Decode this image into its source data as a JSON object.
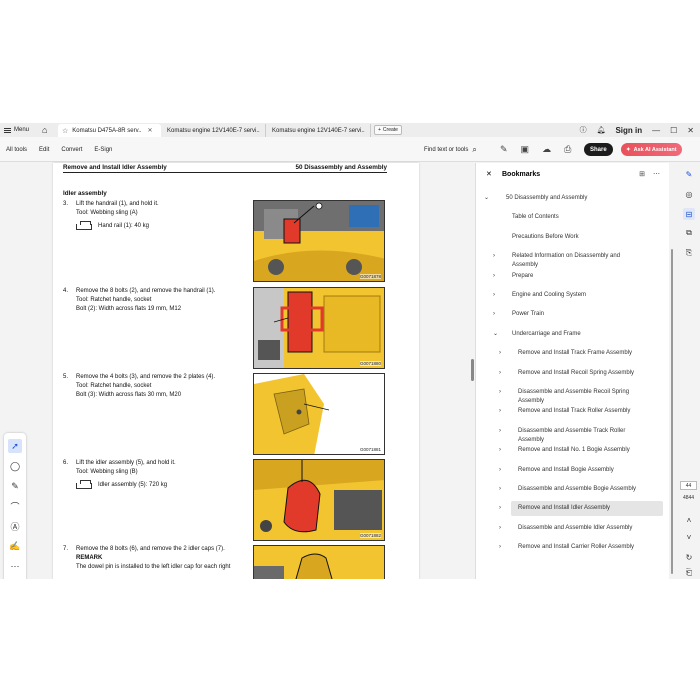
{
  "titlebar": {
    "menu_label": "Menu",
    "tabs": [
      {
        "label": "Komatsu D475A-8R serv..",
        "active": true
      },
      {
        "label": "Komatsu engine 12V140E-7 servi..",
        "active": false
      },
      {
        "label": "Komatsu engine 12V140E-7 servi..",
        "active": false
      }
    ],
    "create_label": "Create",
    "signin_label": "Sign in"
  },
  "toolbar": {
    "items": [
      "All tools",
      "Edit",
      "Convert",
      "E-Sign"
    ],
    "find_label": "Find text or tools",
    "share_label": "Share",
    "ai_label": "Ask AI Assistant"
  },
  "document": {
    "header_left": "Remove and Install Idler Assembly",
    "header_right": "50 Disassembly and Assembly",
    "section_title": "Idler assembly",
    "steps": [
      {
        "num": "3.",
        "lines": [
          "Lift the handrail (1), and hold it.",
          "Tool: Webbing sling (A)"
        ],
        "tag": "Hand rail (1): 40 kg"
      },
      {
        "num": "4.",
        "lines": [
          "Remove the 8 bolts (2), and remove the handrail (1).",
          "Tool: Ratchet handle, socket",
          "Bolt (2): Width across flats 19 mm, M12"
        ]
      },
      {
        "num": "5.",
        "lines": [
          "Remove the 4 bolts (3), and remove the 2 plates (4).",
          "Tool: Ratchet handle, socket",
          "Bolt (3): Width across flats 30 mm, M20"
        ]
      },
      {
        "num": "6.",
        "lines": [
          "Lift the idler assembly (5), and hold it.",
          "Tool: Webbing sling (B)"
        ],
        "tag": "Idler assembly (5): 720 kg"
      },
      {
        "num": "7.",
        "lines": [
          "Remove the 8 bolts (6), and remove the 2 idler caps (7)."
        ],
        "remark": "REMARK",
        "extra": "The dowel pin is installed to the left idler cap for each right"
      }
    ],
    "figure_codes": [
      "G0071878",
      "G0071880",
      "G0071881",
      "G0071882"
    ]
  },
  "bookmarks": {
    "title": "Bookmarks",
    "items": [
      {
        "label": "50 Disassembly and Assembly",
        "level": 0,
        "chevron": "down"
      },
      {
        "label": "Table of Contents",
        "level": 1,
        "chevron": "none"
      },
      {
        "label": "Precautions Before Work",
        "level": 1,
        "chevron": "none"
      },
      {
        "label": "Related Information on Disassembly and",
        "label2": "Assembly",
        "level": 1,
        "chevron": "right"
      },
      {
        "label": "Prepare",
        "level": 1,
        "chevron": "right"
      },
      {
        "label": "Engine and Cooling System",
        "level": 1,
        "chevron": "right"
      },
      {
        "label": "Power Train",
        "level": 1,
        "chevron": "right"
      },
      {
        "label": "Undercarriage and Frame",
        "level": 1,
        "chevron": "down"
      },
      {
        "label": "Remove and Install Track Frame Assembly",
        "level": 2,
        "chevron": "right"
      },
      {
        "label": "Remove and Install Recoil Spring Assembly",
        "level": 2,
        "chevron": "right"
      },
      {
        "label": "Disassemble and Assemble Recoil Spring",
        "label2": "Assembly",
        "level": 2,
        "chevron": "right"
      },
      {
        "label": "Remove and Install Track Roller Assembly",
        "level": 2,
        "chevron": "right"
      },
      {
        "label": "Disassemble and Assemble Track Roller",
        "label2": "Assembly",
        "level": 2,
        "chevron": "right"
      },
      {
        "label": "Remove and Install No. 1 Bogie Assembly",
        "level": 2,
        "chevron": "right"
      },
      {
        "label": "Remove and Install Bogie Assembly",
        "level": 2,
        "chevron": "right"
      },
      {
        "label": "Disassemble and Assemble Bogie Assembly",
        "level": 2,
        "chevron": "right"
      },
      {
        "label": "Remove and Install Idler Assembly",
        "level": 2,
        "chevron": "right",
        "selected": true
      },
      {
        "label": "Disassemble and Assemble Idler Assembly",
        "level": 2,
        "chevron": "right"
      },
      {
        "label": "Remove and Install Carrier Roller Assembly",
        "level": 2,
        "chevron": "right"
      }
    ]
  },
  "right_rail": {
    "page_current": "44",
    "page_total": "4844"
  },
  "colors": {
    "accent_blue": "#1a4fd1",
    "ai_button": "#e8515b",
    "figure_yellow": "#f2c530",
    "figure_red": "#e23a2a"
  }
}
